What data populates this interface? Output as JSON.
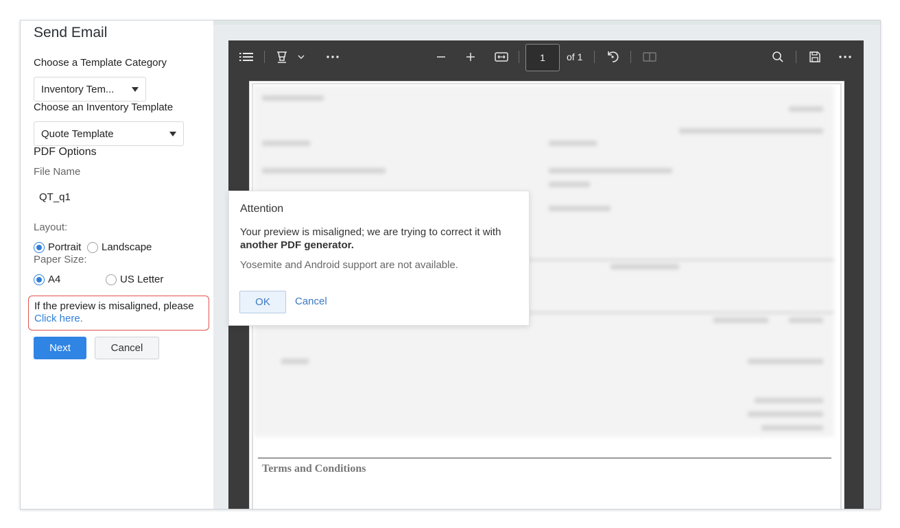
{
  "left_panel": {
    "title": "Send Email",
    "template_category_label": "Choose a Template Category",
    "template_category_value": "Inventory Tem...",
    "inventory_template_label": "Choose an Inventory Template",
    "inventory_template_value": "Quote Template",
    "pdf_options_label": "PDF Options",
    "file_name_label": "File Name",
    "file_name_value": "QT_q1",
    "layout_label": "Layout:",
    "layout_options": [
      {
        "label": "Portrait",
        "selected": true
      },
      {
        "label": "Landscape",
        "selected": false
      }
    ],
    "paper_size_label": "Paper Size:",
    "paper_size_options": [
      {
        "label": "A4",
        "selected": true
      },
      {
        "label": "US Letter",
        "selected": false
      }
    ],
    "notice_text": "If the preview is misaligned, please",
    "notice_link": "Click here.",
    "next_button": "Next",
    "cancel_button": "Cancel"
  },
  "viewer": {
    "toolbar": {
      "icons": [
        "list-icon",
        "highlighter-icon",
        "chevron-down-icon",
        "more-icon",
        "zoom-out-icon",
        "zoom-in-icon",
        "fit-width-icon",
        "rotate-icon",
        "two-page-icon",
        "search-icon",
        "save-icon",
        "more-icon"
      ],
      "current_page": "1",
      "page_count_label": "of 1"
    },
    "page": {
      "terms_heading": "Terms and Conditions"
    }
  },
  "dialog": {
    "title": "Attention",
    "message_prefix": "Your preview is misaligned; we are trying to correct it with ",
    "message_bold": "another PDF generator.",
    "note": "Yosemite and Android support are not available.",
    "ok_button": "OK",
    "cancel_button": "Cancel"
  },
  "colors": {
    "primary_button": "#2f84e4",
    "link": "#2f7fd8",
    "notice_border": "#e0524c",
    "viewer_background": "#3b3b3b"
  }
}
